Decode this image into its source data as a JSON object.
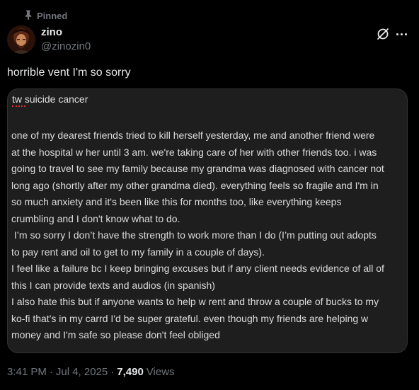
{
  "pinned": {
    "label": "Pinned"
  },
  "author": {
    "display_name": "zino",
    "handle": "@zinozin0"
  },
  "post": {
    "text": "horrible vent I'm so sorry",
    "image_title": "tw suicide cancer",
    "image_body": "one of my dearest friends tried to kill herself yesterday, me and another friend were\nat the hospital w her until 3 am. we're taking care of her with other friends too. i was\ngoing to travel to see my family because my grandma was diagnosed with cancer not\nlong ago (shortly after my other grandma died). everything feels so fragile and I'm in\nso much anxiety and it's been like this for months too, like everything keeps\ncrumbling and I don't know what to do.\n I’m so sorry I don’t have the strength to work more than I do (I’m putting out adopts\nto pay rent and oil to get to my family in a couple of days).\nI feel like a failure bc I keep bringing excuses but if any client needs evidence of all of\nthis I can provide texts and audios (in spanish)\nI also hate this but if anyone wants to help w rent and throw a couple of bucks to my\nko-fi that's in my carrd I'd be super grateful. even though my friends are helping w\nmoney and I'm safe so please don't feel obliged"
  },
  "meta": {
    "time": "3:41 PM",
    "separator": "·",
    "date": "Jul 4, 2025",
    "views_count": "7,490",
    "views_label": "Views"
  },
  "icons": {
    "pin": "pin-icon",
    "grok": "grok-icon",
    "more": "more-icon"
  },
  "colors": {
    "background": "#000000",
    "primary_text": "#e7e9ea",
    "secondary_text": "#71767b",
    "card_background": "#1e1e1e",
    "spellcheck_underline": "#d93030"
  }
}
